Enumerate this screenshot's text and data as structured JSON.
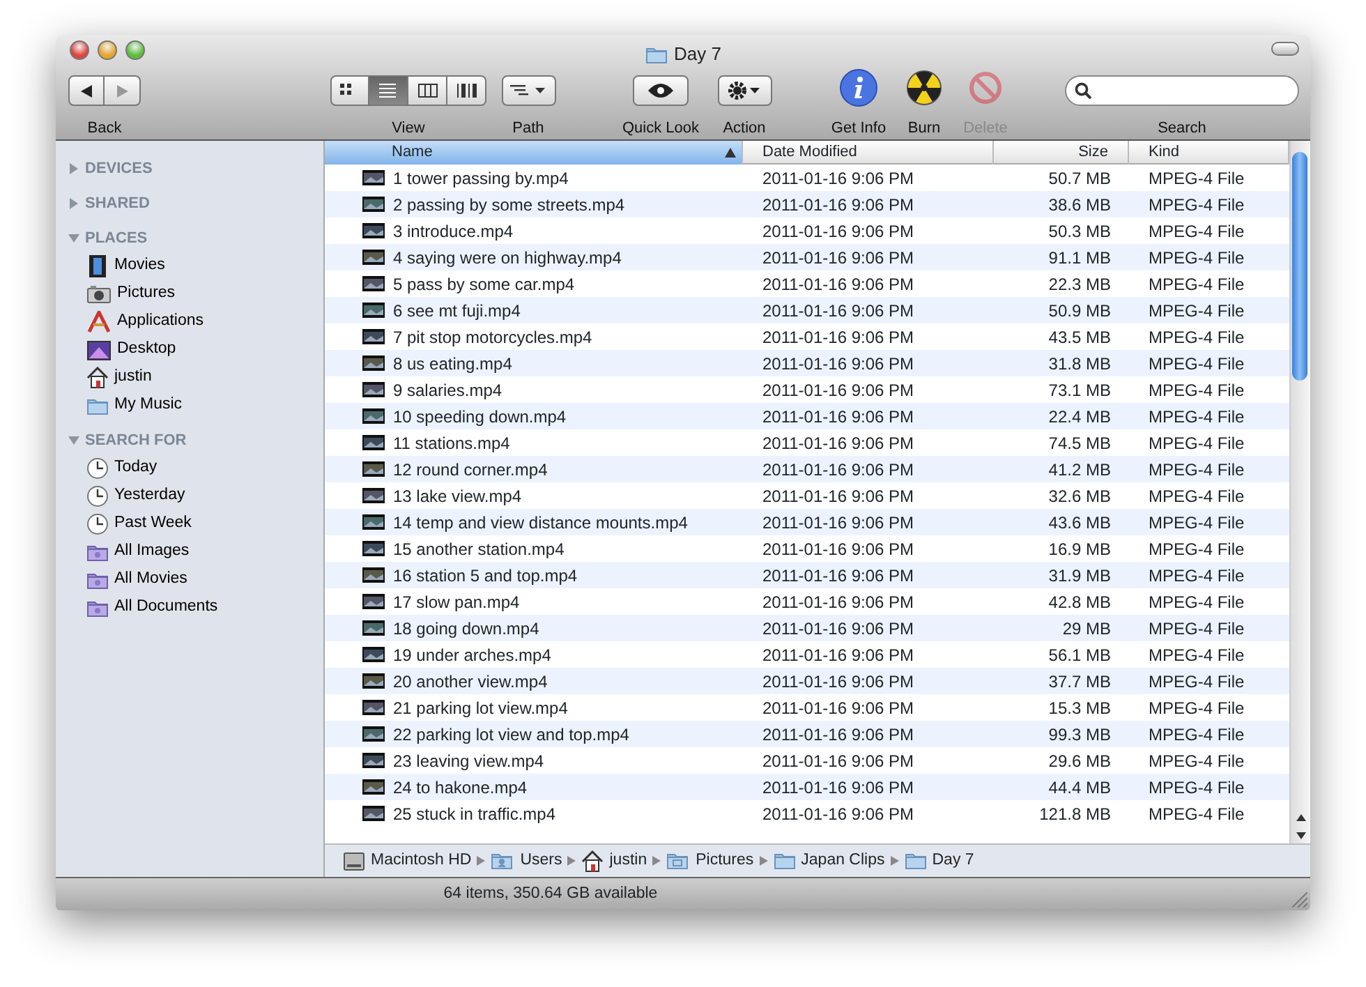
{
  "window": {
    "title": "Day 7"
  },
  "toolbar": {
    "items": [
      {
        "kind": "back",
        "label": "Back"
      },
      {
        "kind": "view",
        "label": "View",
        "options": [
          {
            "selected": false
          },
          {
            "selected": true
          },
          {
            "selected": false
          },
          {
            "selected": false
          }
        ]
      },
      {
        "kind": "path",
        "label": "Path"
      },
      {
        "kind": "quicklook",
        "label": "Quick Look"
      },
      {
        "kind": "action",
        "label": "Action"
      },
      {
        "kind": "info",
        "label": "Get Info",
        "disabled": false
      },
      {
        "kind": "burn",
        "label": "Burn",
        "disabled": false
      },
      {
        "kind": "delete",
        "label": "Delete",
        "disabled": true
      },
      {
        "kind": "search",
        "label": "Search"
      }
    ]
  },
  "sidebar": {
    "sections": [
      {
        "title": "DEVICES",
        "expanded": false
      },
      {
        "title": "SHARED",
        "expanded": false
      },
      {
        "title": "PLACES",
        "expanded": true,
        "items": [
          {
            "label": "Movies",
            "kind": "film"
          },
          {
            "label": "Pictures",
            "kind": "camera"
          },
          {
            "label": "Applications",
            "kind": "apps"
          },
          {
            "label": "Desktop",
            "kind": "desktop"
          },
          {
            "label": "justin",
            "kind": "home"
          },
          {
            "label": "My Music",
            "kind": "folder"
          }
        ]
      },
      {
        "title": "SEARCH FOR",
        "expanded": true,
        "items": [
          {
            "label": "Today",
            "kind": "clock"
          },
          {
            "label": "Yesterday",
            "kind": "clock"
          },
          {
            "label": "Past Week",
            "kind": "clock"
          },
          {
            "label": "All Images",
            "kind": "smart"
          },
          {
            "label": "All Movies",
            "kind": "smart"
          },
          {
            "label": "All Documents",
            "kind": "smart"
          }
        ]
      }
    ]
  },
  "table": {
    "columns": [
      {
        "label": "Name",
        "sorted": true
      },
      {
        "label": "Date Modified",
        "sorted": false
      },
      {
        "label": "Size",
        "sorted": false
      },
      {
        "label": "Kind",
        "sorted": false
      }
    ],
    "rows": [
      {
        "name": "1 tower passing by.mp4",
        "date": "2011-01-16 9:06 PM",
        "size": "50.7 MB",
        "kind": "MPEG-4 File"
      },
      {
        "name": "2 passing by some streets.mp4",
        "date": "2011-01-16 9:06 PM",
        "size": "38.6 MB",
        "kind": "MPEG-4 File"
      },
      {
        "name": "3 introduce.mp4",
        "date": "2011-01-16 9:06 PM",
        "size": "50.3 MB",
        "kind": "MPEG-4 File"
      },
      {
        "name": "4 saying were on highway.mp4",
        "date": "2011-01-16 9:06 PM",
        "size": "91.1 MB",
        "kind": "MPEG-4 File"
      },
      {
        "name": "5 pass by some car.mp4",
        "date": "2011-01-16 9:06 PM",
        "size": "22.3 MB",
        "kind": "MPEG-4 File"
      },
      {
        "name": "6 see mt fuji.mp4",
        "date": "2011-01-16 9:06 PM",
        "size": "50.9 MB",
        "kind": "MPEG-4 File"
      },
      {
        "name": "7 pit stop motorcycles.mp4",
        "date": "2011-01-16 9:06 PM",
        "size": "43.5 MB",
        "kind": "MPEG-4 File"
      },
      {
        "name": "8 us eating.mp4",
        "date": "2011-01-16 9:06 PM",
        "size": "31.8 MB",
        "kind": "MPEG-4 File"
      },
      {
        "name": "9 salaries.mp4",
        "date": "2011-01-16 9:06 PM",
        "size": "73.1 MB",
        "kind": "MPEG-4 File"
      },
      {
        "name": "10 speeding down.mp4",
        "date": "2011-01-16 9:06 PM",
        "size": "22.4 MB",
        "kind": "MPEG-4 File"
      },
      {
        "name": "11 stations.mp4",
        "date": "2011-01-16 9:06 PM",
        "size": "74.5 MB",
        "kind": "MPEG-4 File"
      },
      {
        "name": "12 round corner.mp4",
        "date": "2011-01-16 9:06 PM",
        "size": "41.2 MB",
        "kind": "MPEG-4 File"
      },
      {
        "name": "13 lake view.mp4",
        "date": "2011-01-16 9:06 PM",
        "size": "32.6 MB",
        "kind": "MPEG-4 File"
      },
      {
        "name": "14 temp and view distance mounts.mp4",
        "date": "2011-01-16 9:06 PM",
        "size": "43.6 MB",
        "kind": "MPEG-4 File"
      },
      {
        "name": "15 another station.mp4",
        "date": "2011-01-16 9:06 PM",
        "size": "16.9 MB",
        "kind": "MPEG-4 File"
      },
      {
        "name": "16 station 5 and top.mp4",
        "date": "2011-01-16 9:06 PM",
        "size": "31.9 MB",
        "kind": "MPEG-4 File"
      },
      {
        "name": "17 slow pan.mp4",
        "date": "2011-01-16 9:06 PM",
        "size": "42.8 MB",
        "kind": "MPEG-4 File"
      },
      {
        "name": "18 going down.mp4",
        "date": "2011-01-16 9:06 PM",
        "size": "29 MB",
        "kind": "MPEG-4 File"
      },
      {
        "name": "19 under arches.mp4",
        "date": "2011-01-16 9:06 PM",
        "size": "56.1 MB",
        "kind": "MPEG-4 File"
      },
      {
        "name": "20 another view.mp4",
        "date": "2011-01-16 9:06 PM",
        "size": "37.7 MB",
        "kind": "MPEG-4 File"
      },
      {
        "name": "21 parking lot view.mp4",
        "date": "2011-01-16 9:06 PM",
        "size": "15.3 MB",
        "kind": "MPEG-4 File"
      },
      {
        "name": "22 parking lot view and top.mp4",
        "date": "2011-01-16 9:06 PM",
        "size": "99.3 MB",
        "kind": "MPEG-4 File"
      },
      {
        "name": "23 leaving view.mp4",
        "date": "2011-01-16 9:06 PM",
        "size": "29.6 MB",
        "kind": "MPEG-4 File"
      },
      {
        "name": "24 to hakone.mp4",
        "date": "2011-01-16 9:06 PM",
        "size": "44.4 MB",
        "kind": "MPEG-4 File"
      },
      {
        "name": "25 stuck in traffic.mp4",
        "date": "2011-01-16 9:06 PM",
        "size": "121.8 MB",
        "kind": "MPEG-4 File"
      }
    ]
  },
  "path_bar": [
    {
      "label": "Macintosh HD",
      "kind": "disk"
    },
    {
      "label": "Users",
      "kind": "users"
    },
    {
      "label": "justin",
      "kind": "home"
    },
    {
      "label": "Pictures",
      "kind": "pictures"
    },
    {
      "label": "Japan Clips",
      "kind": "folder"
    },
    {
      "label": "Day 7",
      "kind": "folder"
    }
  ],
  "status_bar": "64 items, 350.64 GB available"
}
